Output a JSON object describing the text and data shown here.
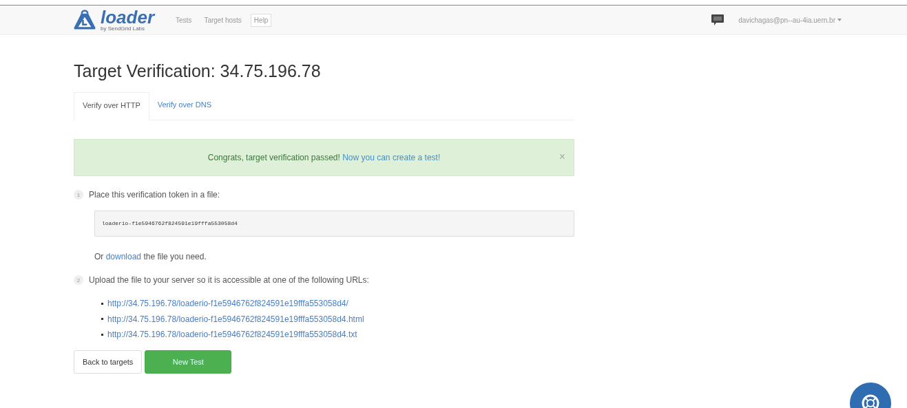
{
  "navbar": {
    "logo": {
      "name": "loader",
      "tagline": "by SendGrid Labs"
    },
    "nav_items": [
      {
        "label": "Tests",
        "selected": false
      },
      {
        "label": "Target hosts",
        "selected": false
      },
      {
        "label": "Help",
        "selected": true
      }
    ],
    "user": "davichagas@pn--au-4ia.uern.br"
  },
  "title": "Target Verification: 34.75.196.78",
  "tabs": [
    {
      "label": "Verify over HTTP",
      "selected": true
    },
    {
      "label": "Verify over DNS",
      "selected": false
    }
  ],
  "alert": {
    "message": "Congrats, target verification passed!",
    "link": "Now you can create a test!",
    "close": "×"
  },
  "steps": [
    {
      "number": "1",
      "text": "Place this verification token in a file:"
    },
    {
      "number": "2",
      "text": "Upload the file to your server so it is accessible at one of the following URLs:"
    }
  ],
  "token": "loaderio-f1e5946762f824591e19fffa553058d4",
  "download_line": {
    "before": "Or",
    "link": "download",
    "after": "the file you need."
  },
  "urls": [
    "http://34.75.196.78/loaderio-f1e5946762f824591e19fffa553058d4/",
    "http://34.75.196.78/loaderio-f1e5946762f824591e19fffa553058d4.html",
    "http://34.75.196.78/loaderio-f1e5946762f824591e19fffa553058d4.txt"
  ],
  "buttons": [
    {
      "label": "Back to targets",
      "kind": "default"
    },
    {
      "label": "New Test",
      "kind": "success"
    }
  ]
}
